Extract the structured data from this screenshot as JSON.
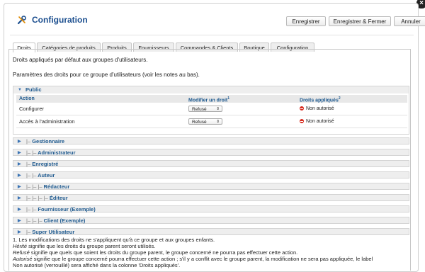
{
  "header": {
    "title": "Configuration",
    "buttons": {
      "save": "Enregistrer",
      "save_close": "Enregistrer & Fermer",
      "cancel": "Annuler"
    }
  },
  "tabs": [
    "Droits",
    "Catégories de produits",
    "Produits",
    "Fournisseurs",
    "Commandes & Clients",
    "Boutique",
    "Configuration"
  ],
  "intro": {
    "line1": "Droits appliqués par défaut aux groupes d'utilisateurs.",
    "line2": "Paramètres des droits pour ce groupe d'utilisateurs (voir les notes au bas)."
  },
  "public_group": {
    "label": "Public",
    "columns": {
      "action": "Action",
      "modify": "Modifier un droit",
      "modify_sup": "1",
      "applied": "Droits appliqués",
      "applied_sup": "2"
    },
    "rows": [
      {
        "action": "Configurer",
        "select": "Refusé",
        "status": "Non autorisé"
      },
      {
        "action": "Accès à l'administration",
        "select": "Refusé",
        "status": "Non autorisé"
      }
    ]
  },
  "groups": [
    {
      "prefix": "|–",
      "label": "Gestionnaire"
    },
    {
      "prefix": "|– |–",
      "label": "Administrateur"
    },
    {
      "prefix": "|–",
      "label": "Enregistré"
    },
    {
      "prefix": "|– |–",
      "label": "Auteur"
    },
    {
      "prefix": "|– |– |–",
      "label": "Rédacteur"
    },
    {
      "prefix": "|– |– |– |–",
      "label": "Éditeur"
    },
    {
      "prefix": "|– |–",
      "label": "Fournisseur (Exemple)"
    },
    {
      "prefix": "|– |– |–",
      "label": "Client (Exemple)"
    },
    {
      "prefix": "|–",
      "label": "Super Utilisateur"
    }
  ],
  "notes": {
    "n1": "1. Les modifications des droits ne s'appliquent qu'à ce groupe et aux groupes enfants.",
    "n2_em": "Hérité",
    "n2": " signifie que les droits du groupe parent seront utilisés.",
    "n3_em": "Refusé",
    "n3": " signifie que quels que soient les droits du groupe parent, le groupe concerné ne pourra pas effectuer cette action.",
    "n4_em": "Autorisé",
    "n4": " signifie que le groupe concerné pourra effectuer cette action ; s'il y a conflit avec le groupe parent, la modification ne sera pas appliquée, le label",
    "n5": "Non autorisé (verrouillé) sera affiché dans la colonne 'Droits appliqués'."
  }
}
